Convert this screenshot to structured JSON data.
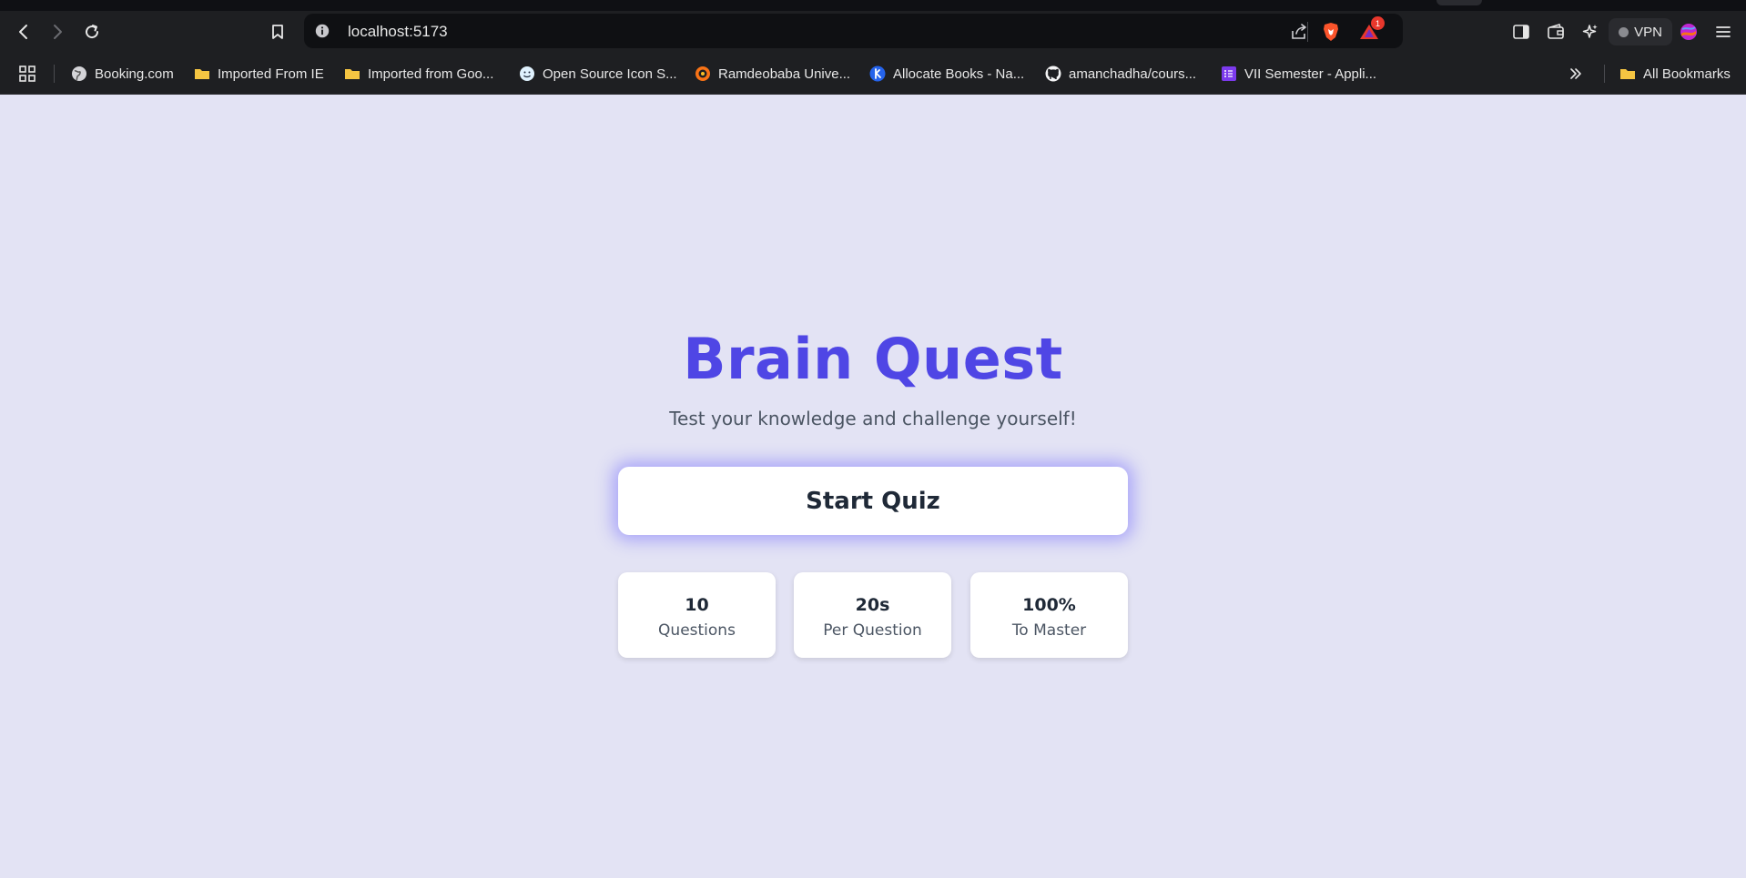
{
  "browser": {
    "url": "localhost:5173",
    "notification_count": "1",
    "vpn_label": "VPN",
    "bookmarks": [
      {
        "label": "Booking.com",
        "icon": "globe-icon"
      },
      {
        "label": "Imported From IE",
        "icon": "folder-icon"
      },
      {
        "label": "Imported from Goo...",
        "icon": "folder-icon"
      },
      {
        "label": "Open Source Icon S...",
        "icon": "smiley-icon"
      },
      {
        "label": "Ramdeobaba Unive...",
        "icon": "university-icon"
      },
      {
        "label": "Allocate Books - Na...",
        "icon": "book-icon"
      },
      {
        "label": "amanchadha/cours...",
        "icon": "github-icon"
      },
      {
        "label": "VII Semester - Appli...",
        "icon": "forms-icon"
      }
    ],
    "all_bookmarks_label": "All Bookmarks"
  },
  "page": {
    "title": "Brain Quest",
    "subtitle": "Test your knowledge and challenge yourself!",
    "start_button": "Start Quiz",
    "stats": [
      {
        "value": "10",
        "label": "Questions"
      },
      {
        "value": "20s",
        "label": "Per Question"
      },
      {
        "value": "100%",
        "label": "To Master"
      }
    ]
  },
  "colors": {
    "background": "#e3e3f4",
    "accent": "#4f46e5",
    "chrome": "#1e1f22"
  }
}
